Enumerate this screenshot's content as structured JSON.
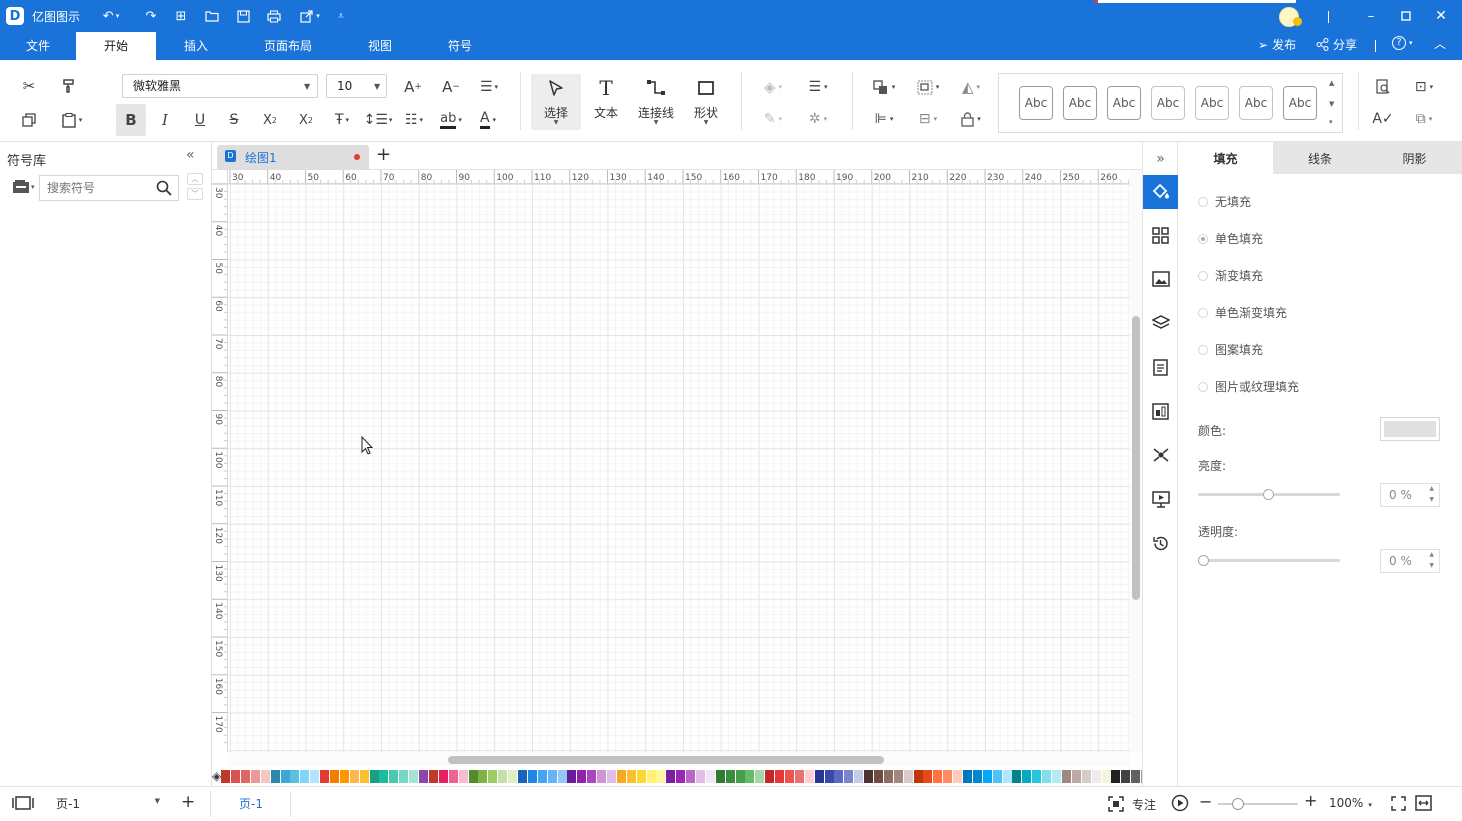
{
  "app": {
    "title": "亿图图示"
  },
  "menu": {
    "tabs": [
      "文件",
      "开始",
      "插入",
      "页面布局",
      "视图",
      "符号"
    ],
    "publish": "发布",
    "share": "分享"
  },
  "ribbon": {
    "font_name": "微软雅黑",
    "font_size": "10",
    "select_label": "选择",
    "text_label": "文本",
    "connector_label": "连接线",
    "shape_label": "形状",
    "style_samples": [
      "Abc",
      "Abc",
      "Abc",
      "Abc",
      "Abc",
      "Abc",
      "Abc"
    ]
  },
  "symbol_panel": {
    "title": "符号库",
    "search_placeholder": "搜索符号"
  },
  "document": {
    "tab_name": "绘图1"
  },
  "ruler": {
    "top": [
      "30",
      "40",
      "50",
      "60",
      "70",
      "80",
      "90",
      "100",
      "110",
      "120",
      "130",
      "140",
      "150",
      "160",
      "170",
      "180",
      "190",
      "200",
      "210",
      "220",
      "230",
      "240",
      "250",
      "260"
    ],
    "left": [
      "30",
      "40",
      "50",
      "60",
      "70",
      "80",
      "90",
      "100",
      "110",
      "120",
      "130",
      "140",
      "150",
      "160",
      "170"
    ]
  },
  "right_panel": {
    "tabs": [
      "填充",
      "线条",
      "阴影"
    ],
    "active_tab": "填充",
    "fill_options": [
      "无填充",
      "单色填充",
      "渐变填充",
      "单色渐变填充",
      "图案填充",
      "图片或纹理填充"
    ],
    "selected_fill": "单色填充",
    "color_label": "颜色:",
    "color_value": "#e0e0e0",
    "brightness_label": "亮度:",
    "brightness_value": "0 %",
    "transparency_label": "透明度:",
    "transparency_value": "0 %"
  },
  "status": {
    "page_selector": "页-1",
    "page_tab": "页-1",
    "focus_label": "专注",
    "zoom": "100%"
  },
  "colors": {
    "accent": "#1a73d9",
    "palette": [
      "#c0392b",
      "#d9534f",
      "#e06666",
      "#ea9999",
      "#f4c7c3",
      "#2e86ab",
      "#3fa7d6",
      "#5bc0de",
      "#81d4fa",
      "#b3e5fc",
      "#e53935",
      "#f57c00",
      "#ff9800",
      "#ffb74d",
      "#fbc02d",
      "#16a085",
      "#1abc9c",
      "#48c9b0",
      "#76d7c4",
      "#a3e4d7",
      "#8e44ad",
      "#c0392b",
      "#e91e63",
      "#f06292",
      "#f8bbd0",
      "#558b2f",
      "#7cb342",
      "#9ccc65",
      "#c5e1a5",
      "#dcedc8",
      "#1565c0",
      "#1e88e5",
      "#42a5f5",
      "#64b5f6",
      "#90caf9",
      "#6a1b9a",
      "#8e24aa",
      "#ab47bc",
      "#ce93d8",
      "#e1bee7",
      "#f9a825",
      "#fbc02d",
      "#fdd835",
      "#fff176",
      "#fff59d",
      "#7b1fa2",
      "#9c27b0",
      "#ba68c8",
      "#e1bee7",
      "#f3e5f5",
      "#2e7d32",
      "#388e3c",
      "#43a047",
      "#66bb6a",
      "#a5d6a7",
      "#c62828",
      "#e53935",
      "#ef5350",
      "#e57373",
      "#ffcdd2",
      "#283593",
      "#3949ab",
      "#5c6bc0",
      "#7986cb",
      "#c5cae9",
      "#4e342e",
      "#6d4c41",
      "#8d6e63",
      "#a1887f",
      "#d7ccc8",
      "#bf360c",
      "#e64a19",
      "#ff7043",
      "#ff8a65",
      "#ffccbc",
      "#0277bd",
      "#0288d1",
      "#03a9f4",
      "#4fc3f7",
      "#b3e5fc",
      "#00838f",
      "#00acc1",
      "#26c6da",
      "#80deea",
      "#b2ebf2",
      "#a1887f",
      "#bcaaa4",
      "#d7ccc8",
      "#efebe9",
      "#f5f5dc",
      "#212121",
      "#424242",
      "#616161",
      "#9e9e9e",
      "#bdbdbd",
      "#e0e0e0",
      "#eeeeee",
      "#f5f5f5"
    ]
  }
}
